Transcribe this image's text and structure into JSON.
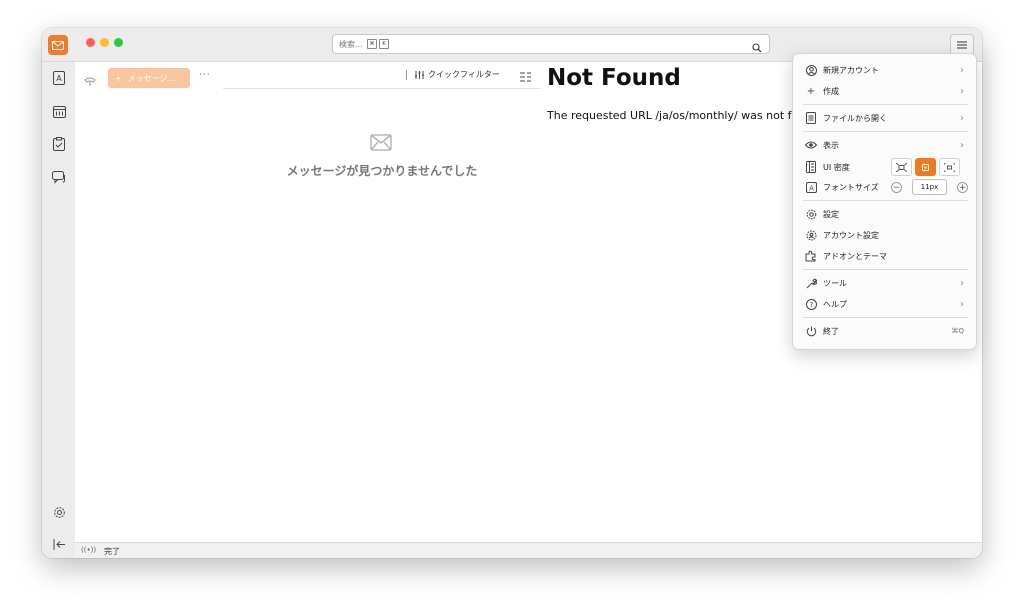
{
  "search": {
    "placeholder": "検索..."
  },
  "folder_pane": {
    "write_label": "メッセージ...",
    "more": "···"
  },
  "thread_pane": {
    "quick_filter_label": "クイックフィルター",
    "empty_text": "メッセージが見つかりませんでした"
  },
  "message": {
    "title": "Not Found",
    "body": "The requested URL /ja/os/monthly/ was not found on this server."
  },
  "statusbar": {
    "status": "完了"
  },
  "app_menu": {
    "new_account": "新規アカウント",
    "create": "作成",
    "open_file": "ファイルから開く",
    "view": "表示",
    "ui_density": "UI 密度",
    "font_size": "フォントサイズ",
    "font_size_value": "11px",
    "settings": "設定",
    "account_settings": "アカウント設定",
    "addons_themes": "アドオンとテーマ",
    "tools": "ツール",
    "help": "ヘルプ",
    "quit": "終了",
    "quit_shortcut": "⌘Q"
  },
  "colors": {
    "accent": "#f07a20",
    "write_button": "#f9c6a0"
  }
}
